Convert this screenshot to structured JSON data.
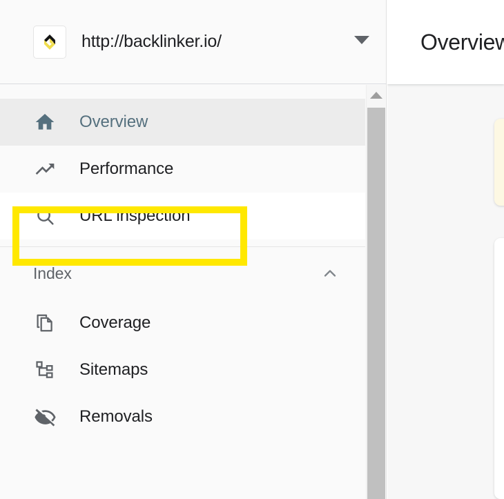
{
  "property": {
    "url": "http://backlinker.io/",
    "logo_icon": "backlinker-logo-icon",
    "logo_colors": {
      "dark": "#1a1a1a",
      "accent": "#f0dd4e"
    },
    "dropdown_icon": "caret-down-icon"
  },
  "sidebar": {
    "items": [
      {
        "label": "Overview",
        "icon": "home-icon",
        "active": true
      },
      {
        "label": "Performance",
        "icon": "trending-up-icon",
        "active": false
      },
      {
        "label": "URL inspection",
        "icon": "search-icon",
        "active": false,
        "highlighted": true
      }
    ],
    "sections": [
      {
        "title": "Index",
        "collapse_icon": "chevron-up-icon",
        "expanded": true,
        "items": [
          {
            "label": "Coverage",
            "icon": "copy-documents-icon"
          },
          {
            "label": "Sitemaps",
            "icon": "account-tree-icon"
          },
          {
            "label": "Removals",
            "icon": "visibility-off-icon"
          }
        ]
      }
    ],
    "active_item_bg": "#ececec",
    "active_item_color": "#55707e"
  },
  "annotation": {
    "target": "URL inspection",
    "color": "#ffe800",
    "style": "rectangle-outline"
  },
  "scrollbar": {
    "up_arrow_icon": "scroll-up-arrow-icon",
    "thumb_color": "#c0c0c0"
  },
  "main": {
    "title": "Overview",
    "cards": [
      {
        "name": "notice-card",
        "color": "#fdf8e3"
      },
      {
        "name": "content-card",
        "color": "#ffffff"
      }
    ]
  }
}
